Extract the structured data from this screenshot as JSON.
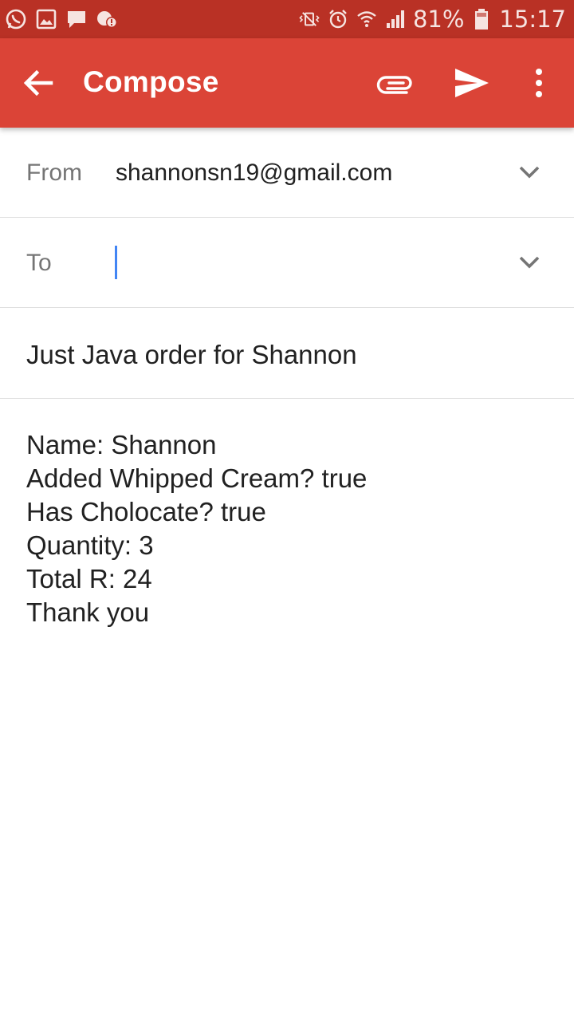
{
  "status_bar": {
    "left_icons": [
      "whatsapp-icon",
      "gallery-icon",
      "message-icon",
      "chat-alert-icon"
    ],
    "right_icons": [
      "vibrate-icon",
      "alarm-icon",
      "wifi-icon",
      "signal-icon"
    ],
    "battery": "81%",
    "time": "15:17"
  },
  "app_bar": {
    "title": "Compose",
    "actions": [
      "attach-icon",
      "send-icon",
      "more-icon"
    ],
    "color": "#db4437"
  },
  "compose": {
    "from_label": "From",
    "from_value": "shannonsn19@gmail.com",
    "to_label": "To",
    "to_value": "",
    "subject": "Just Java order for Shannon",
    "body_lines": [
      "Name: Shannon",
      "Added Whipped Cream? true",
      "Has Cholocate? true",
      "Quantity: 3",
      "Total R: 24",
      "Thank you"
    ]
  }
}
